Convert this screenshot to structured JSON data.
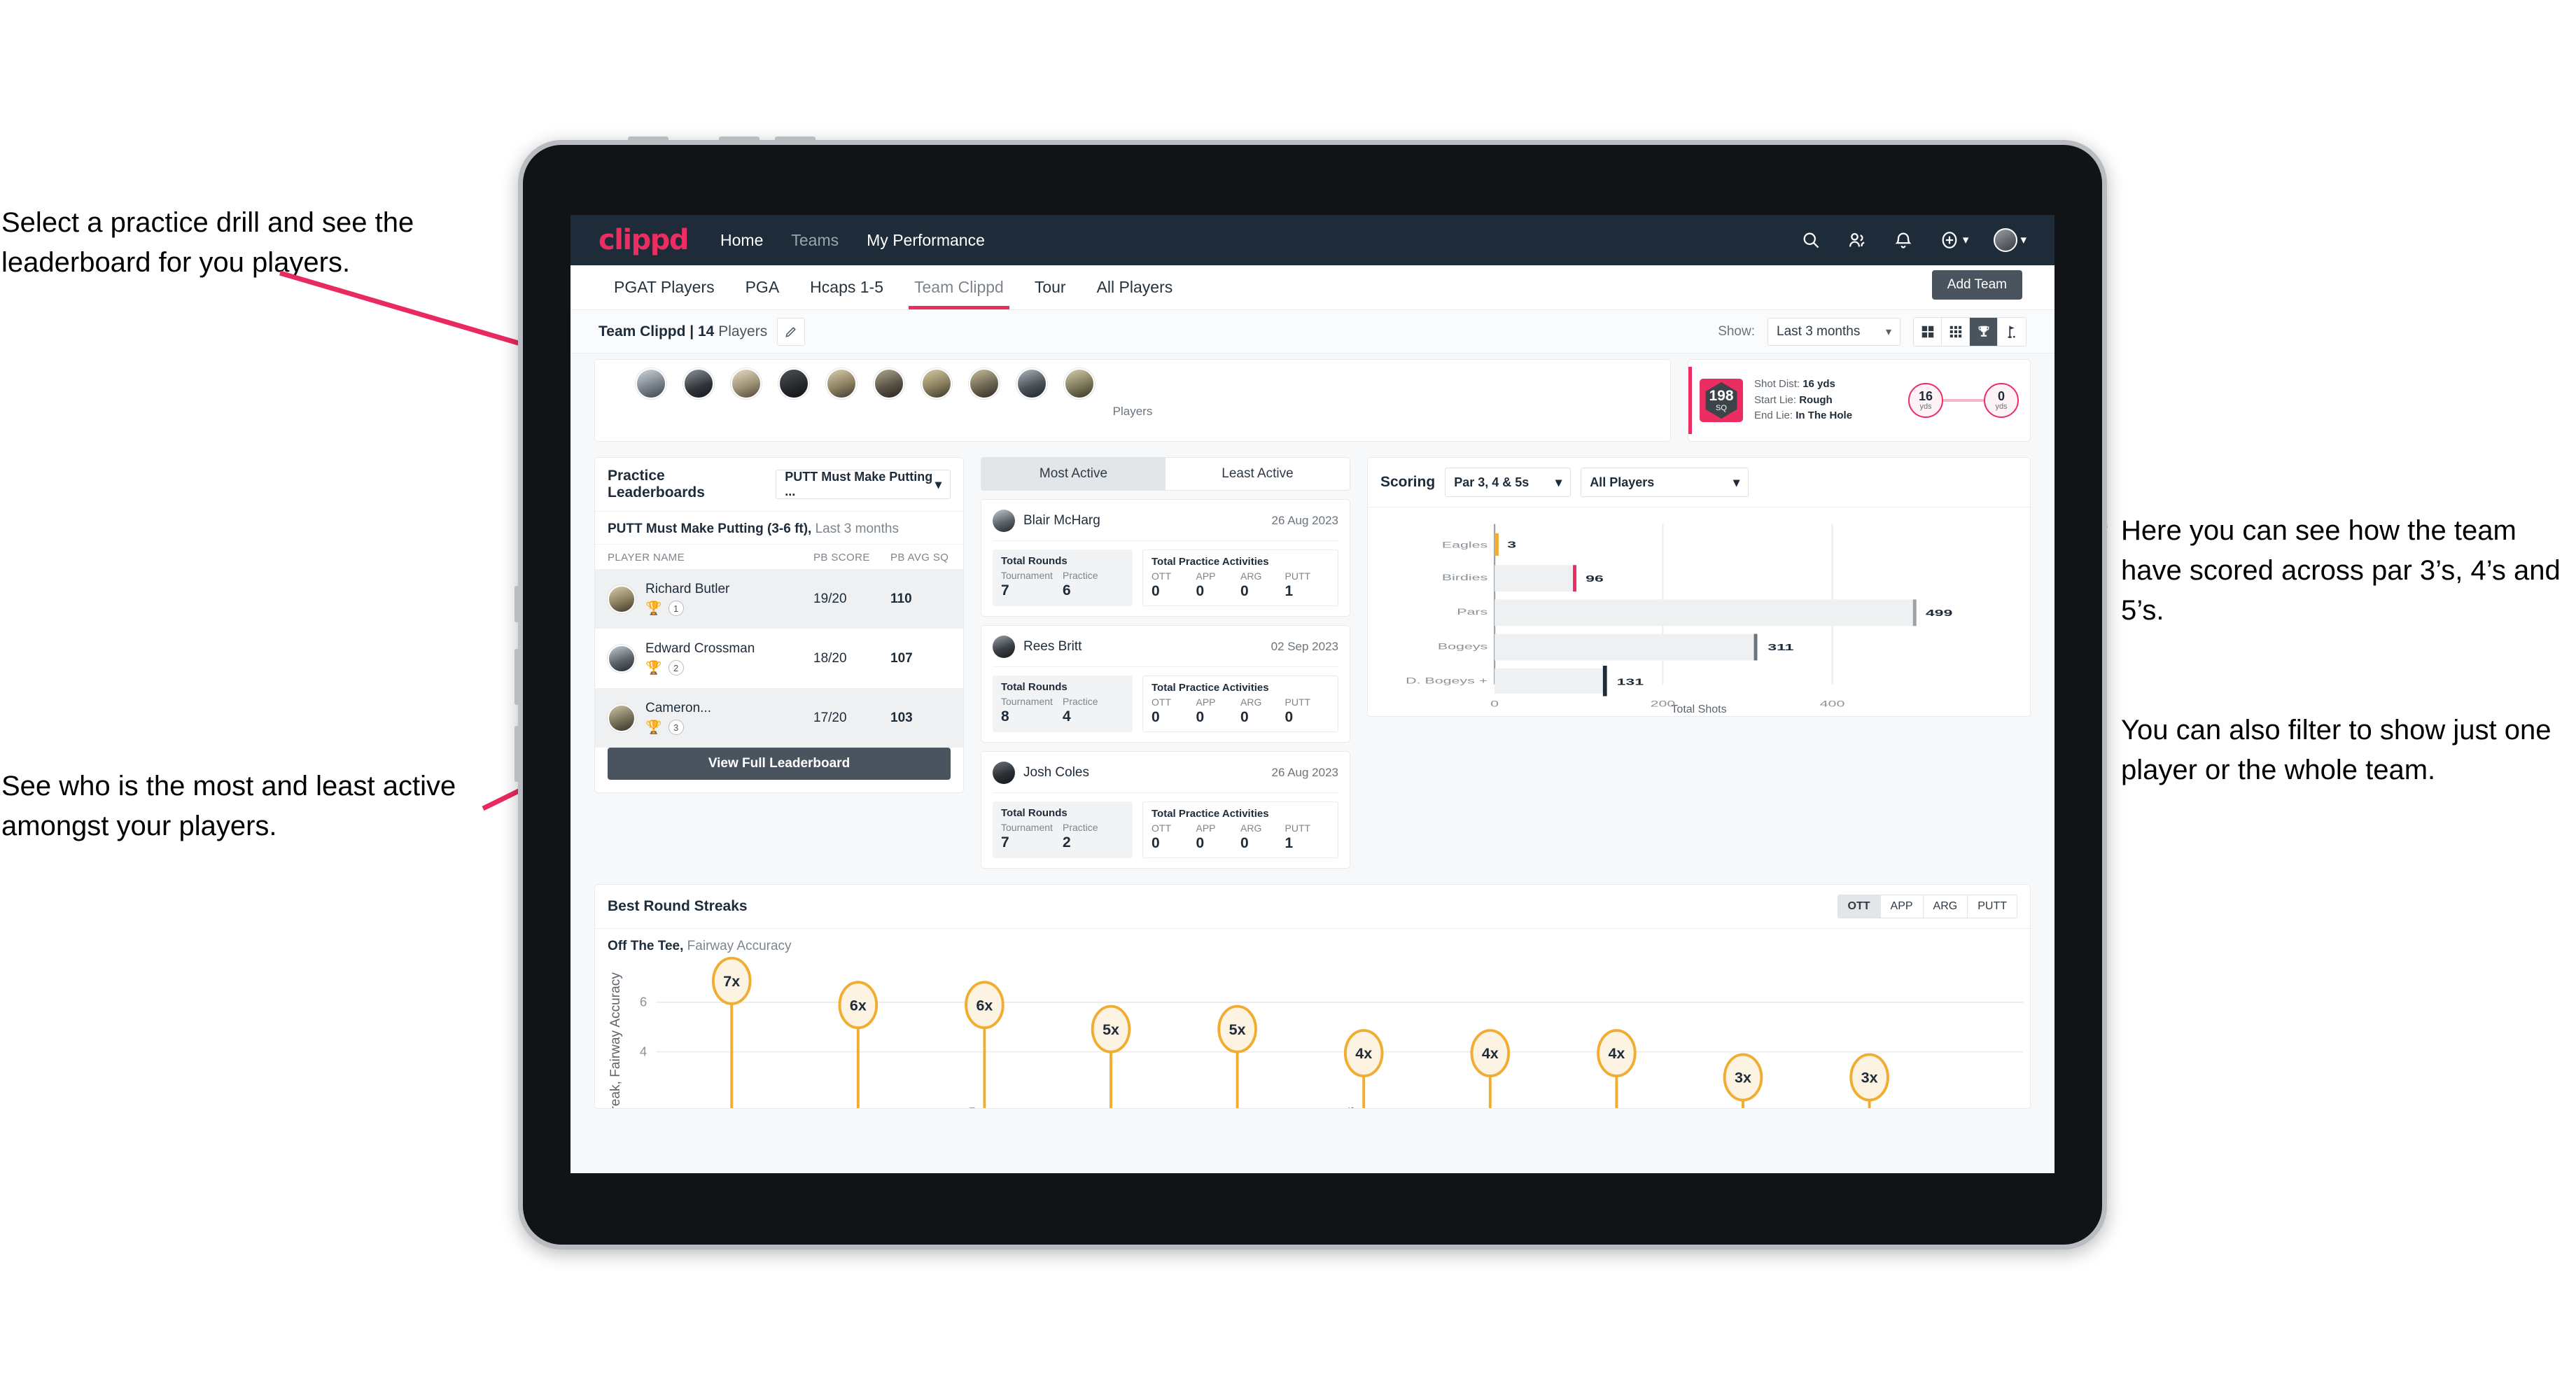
{
  "annotations": {
    "left_top": "Select a practice drill and see the leaderboard for you players.",
    "left_bottom": "See who is the most and least active amongst your players.",
    "right_top": "Here you can see how the team have scored across par 3’s, 4’s and 5’s.",
    "right_bottom": "You can also filter to show just one player or the whole team."
  },
  "topnav": {
    "logo": "clippd",
    "links": [
      {
        "label": "Home",
        "active": true
      },
      {
        "label": "Teams",
        "active": false
      },
      {
        "label": "My Performance",
        "active": true
      }
    ],
    "icons": [
      "search-icon",
      "people-icon",
      "bell-icon",
      "plus-circle-icon",
      "avatar"
    ]
  },
  "tabs": {
    "items": [
      "PGAT Players",
      "PGA",
      "Hcaps 1-5",
      "Team Clippd",
      "Tour",
      "All Players"
    ],
    "active": "Team Clippd",
    "add_team_label": "Add Team"
  },
  "subbar": {
    "team_name": "Team Clippd | 14",
    "team_suffix": " Players",
    "edit_icon": "pencil-icon",
    "show_label": "Show:",
    "period_value": "Last 3 months",
    "view_icons": [
      "grid-large-icon",
      "grid-small-icon",
      "trophy-icon",
      "flag-icon"
    ],
    "view_active": "trophy-icon"
  },
  "players_strip": {
    "label": "Players",
    "count": 10
  },
  "shot_card": {
    "sq_value": "198",
    "sq_unit": "SQ",
    "shot_dist_label": "Shot Dist:",
    "shot_dist_value": "16 yds",
    "start_lie_label": "Start Lie:",
    "start_lie_value": "Rough",
    "end_lie_label": "End Lie:",
    "end_lie_value": "In The Hole",
    "from_value": "16",
    "from_unit": "yds",
    "to_value": "0",
    "to_unit": "yds"
  },
  "leaderboard": {
    "title": "Practice Leaderboards",
    "drill_select": "PUTT Must Make Putting ...",
    "subtitle_bold": "PUTT Must Make Putting (3-6 ft),",
    "subtitle_rest": " Last 3 months",
    "columns": [
      "PLAYER NAME",
      "PB SCORE",
      "PB AVG SQ"
    ],
    "rows": [
      {
        "name": "Richard Butler",
        "rank": "1",
        "trophy": "gold",
        "pb_score": "19/20",
        "pb_avg_sq": "110"
      },
      {
        "name": "Edward Crossman",
        "rank": "2",
        "trophy": "silver",
        "pb_score": "18/20",
        "pb_avg_sq": "107"
      },
      {
        "name": "Cameron...",
        "rank": "3",
        "trophy": "bronze",
        "pb_score": "17/20",
        "pb_avg_sq": "103"
      }
    ],
    "view_full_label": "View Full Leaderboard"
  },
  "activity": {
    "tabs": [
      "Most Active",
      "Least Active"
    ],
    "active_tab": "Most Active",
    "rounds_title": "Total Rounds",
    "practice_title": "Total Practice Activities",
    "rounds_cols": [
      "Tournament",
      "Practice"
    ],
    "practice_cols": [
      "OTT",
      "APP",
      "ARG",
      "PUTT"
    ],
    "cards": [
      {
        "name": "Blair McHarg",
        "date": "26 Aug 2023",
        "tournament": "7",
        "practice": "6",
        "ott": "0",
        "app": "0",
        "arg": "0",
        "putt": "1"
      },
      {
        "name": "Rees Britt",
        "date": "02 Sep 2023",
        "tournament": "8",
        "practice": "4",
        "ott": "0",
        "app": "0",
        "arg": "0",
        "putt": "0"
      },
      {
        "name": "Josh Coles",
        "date": "26 Aug 2023",
        "tournament": "7",
        "practice": "2",
        "ott": "0",
        "app": "0",
        "arg": "0",
        "putt": "1"
      }
    ]
  },
  "scoring": {
    "title": "Scoring",
    "par_select": "Par 3, 4 & 5s",
    "player_select": "All Players"
  },
  "streaks": {
    "title": "Best Round Streaks",
    "segments": [
      "OTT",
      "APP",
      "ARG",
      "PUTT"
    ],
    "segment_active": "OTT",
    "subtitle_bold": "Off The Tee,",
    "subtitle_rest": " Fairway Accuracy"
  },
  "chart_data": [
    {
      "type": "bar",
      "orientation": "horizontal",
      "title": "Scoring",
      "categories": [
        "Eagles",
        "Birdies",
        "Pars",
        "Bogeys",
        "D. Bogeys +"
      ],
      "values": [
        3,
        96,
        499,
        311,
        131
      ],
      "bar_end_colors": [
        "#f0ad31",
        "#ec2d62",
        "#9aa2aa",
        "#6c757d",
        "#1e2c3a"
      ],
      "xlabel": "Total Shots",
      "ylabel": "",
      "xticks": [
        0,
        200,
        400
      ],
      "xlim": [
        0,
        560
      ],
      "grid": true,
      "legend": "none"
    },
    {
      "type": "bar",
      "subtype": "lollipop",
      "title": "Best Round Streaks",
      "series_label": "Off The Tee, Fairway Accuracy",
      "labels": [
        "7x",
        "6x",
        "6x",
        "5x",
        "5x",
        "4x",
        "4x",
        "4x",
        "3x",
        "3x"
      ],
      "values": [
        7,
        6,
        6,
        5,
        5,
        4,
        4,
        4,
        3,
        3
      ],
      "ylabel": "Streak, Fairway Accuracy",
      "yticks": [
        4,
        6
      ],
      "ylim": [
        0,
        8
      ],
      "marker_color": "#f0ad31",
      "marker_fill": "#fdf3e3",
      "grid": true,
      "legend": "none"
    }
  ]
}
